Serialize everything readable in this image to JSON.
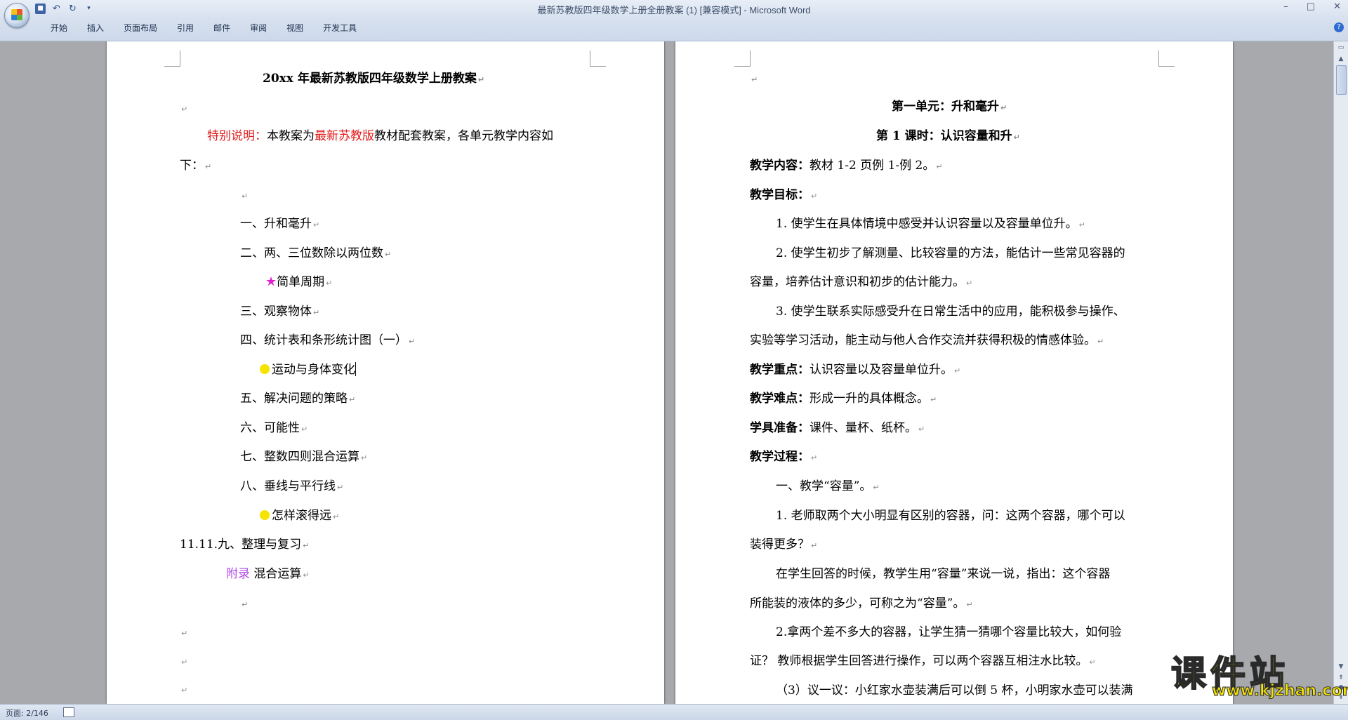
{
  "window": {
    "title": "最新苏教版四年级数学上册全册教案 (1) [兼容模式] - Microsoft Word",
    "controls": [
      "–",
      "□",
      "✕"
    ]
  },
  "quick_access": {
    "icons": [
      "save-icon",
      "undo-icon",
      "redo-icon",
      "customize-icon"
    ]
  },
  "ribbon": {
    "tabs": [
      "开始",
      "插入",
      "页面布局",
      "引用",
      "邮件",
      "审阅",
      "视图",
      "开发工具"
    ]
  },
  "left_page": {
    "title": "20xx 年最新苏教版四年级数学上册教案",
    "intro_red": "特别说明：",
    "intro_text1": "本教案为",
    "intro_red2": "最新苏教版",
    "intro_text2": "教材配套教案，各单元教学内容如",
    "intro_cont": "下：",
    "items": {
      "u1": "一、升和毫升",
      "u2": "二、两、三位数除以两位数",
      "s1": "简单周期",
      "u3": "三、观察物体",
      "u4": "四、统计表和条形统计图（一）",
      "s2": "运动与身体变化",
      "u5": "五、解决问题的策略",
      "u6": "六、可能性",
      "u7": "七、整数四则混合运算",
      "u8": "八、垂线与平行线",
      "s3": "怎样滚得远",
      "u9": "11.11.九、整理与复习",
      "appendix_label": "附录",
      "appendix_text": "混合运算"
    }
  },
  "right_page": {
    "unit_title": "第一单元：升和毫升",
    "lesson_title": "第 1 课时：认识容量和升",
    "content_label": "教学内容：",
    "content_text": "教材 1-2 页例 1-例 2。",
    "goal_label": "教学目标：",
    "goal1": "1. 使学生在具体情境中感受并认识容量以及容量单位升。",
    "goal2a": "2. 使学生初步了解测量、比较容量的方法，能估计一些常见容器的",
    "goal2b": "容量，培养估计意识和初步的估计能力。",
    "goal3a": "3. 使学生联系实际感受升在日常生活中的应用，能积极参与操作、",
    "goal3b": "实验等学习活动，能主动与他人合作交流并获得积极的情感体验。",
    "key_label": "教学重点：",
    "key_text": "认识容量以及容量单位升。",
    "hard_label": "教学难点：",
    "hard_text": "形成一升的具体概念。",
    "tools_label": "学具准备：",
    "tools_text": "课件、量杯、纸杯。",
    "process_label": "教学过程：",
    "p1": "一、教学“容量”。",
    "p2a": "1. 老师取两个大小明显有区别的容器，问：这两个容器，哪个可以",
    "p2b": "装得更多？",
    "p3a": "在学生回答的时候，教学生用“容量”来说一说，指出：这个容器",
    "p3b": "所能装的液体的多少，可称之为“容量”。",
    "p4a": "2.拿两个差不多大的容器，让学生猜一猜哪个容量比较大，如何验",
    "p4b": "证？ 教师根据学生回答进行操作，可以两个容器互相注水比较。",
    "p5": "（3）议一议：小红家水壶装满后可以倒 5 杯，小明家水壶可以装满"
  },
  "status": {
    "page_info": "页面: 2/146"
  },
  "watermark": {
    "main": "课件站",
    "url": "www.kjzhan.com"
  },
  "marks": {
    "para": "↵"
  }
}
